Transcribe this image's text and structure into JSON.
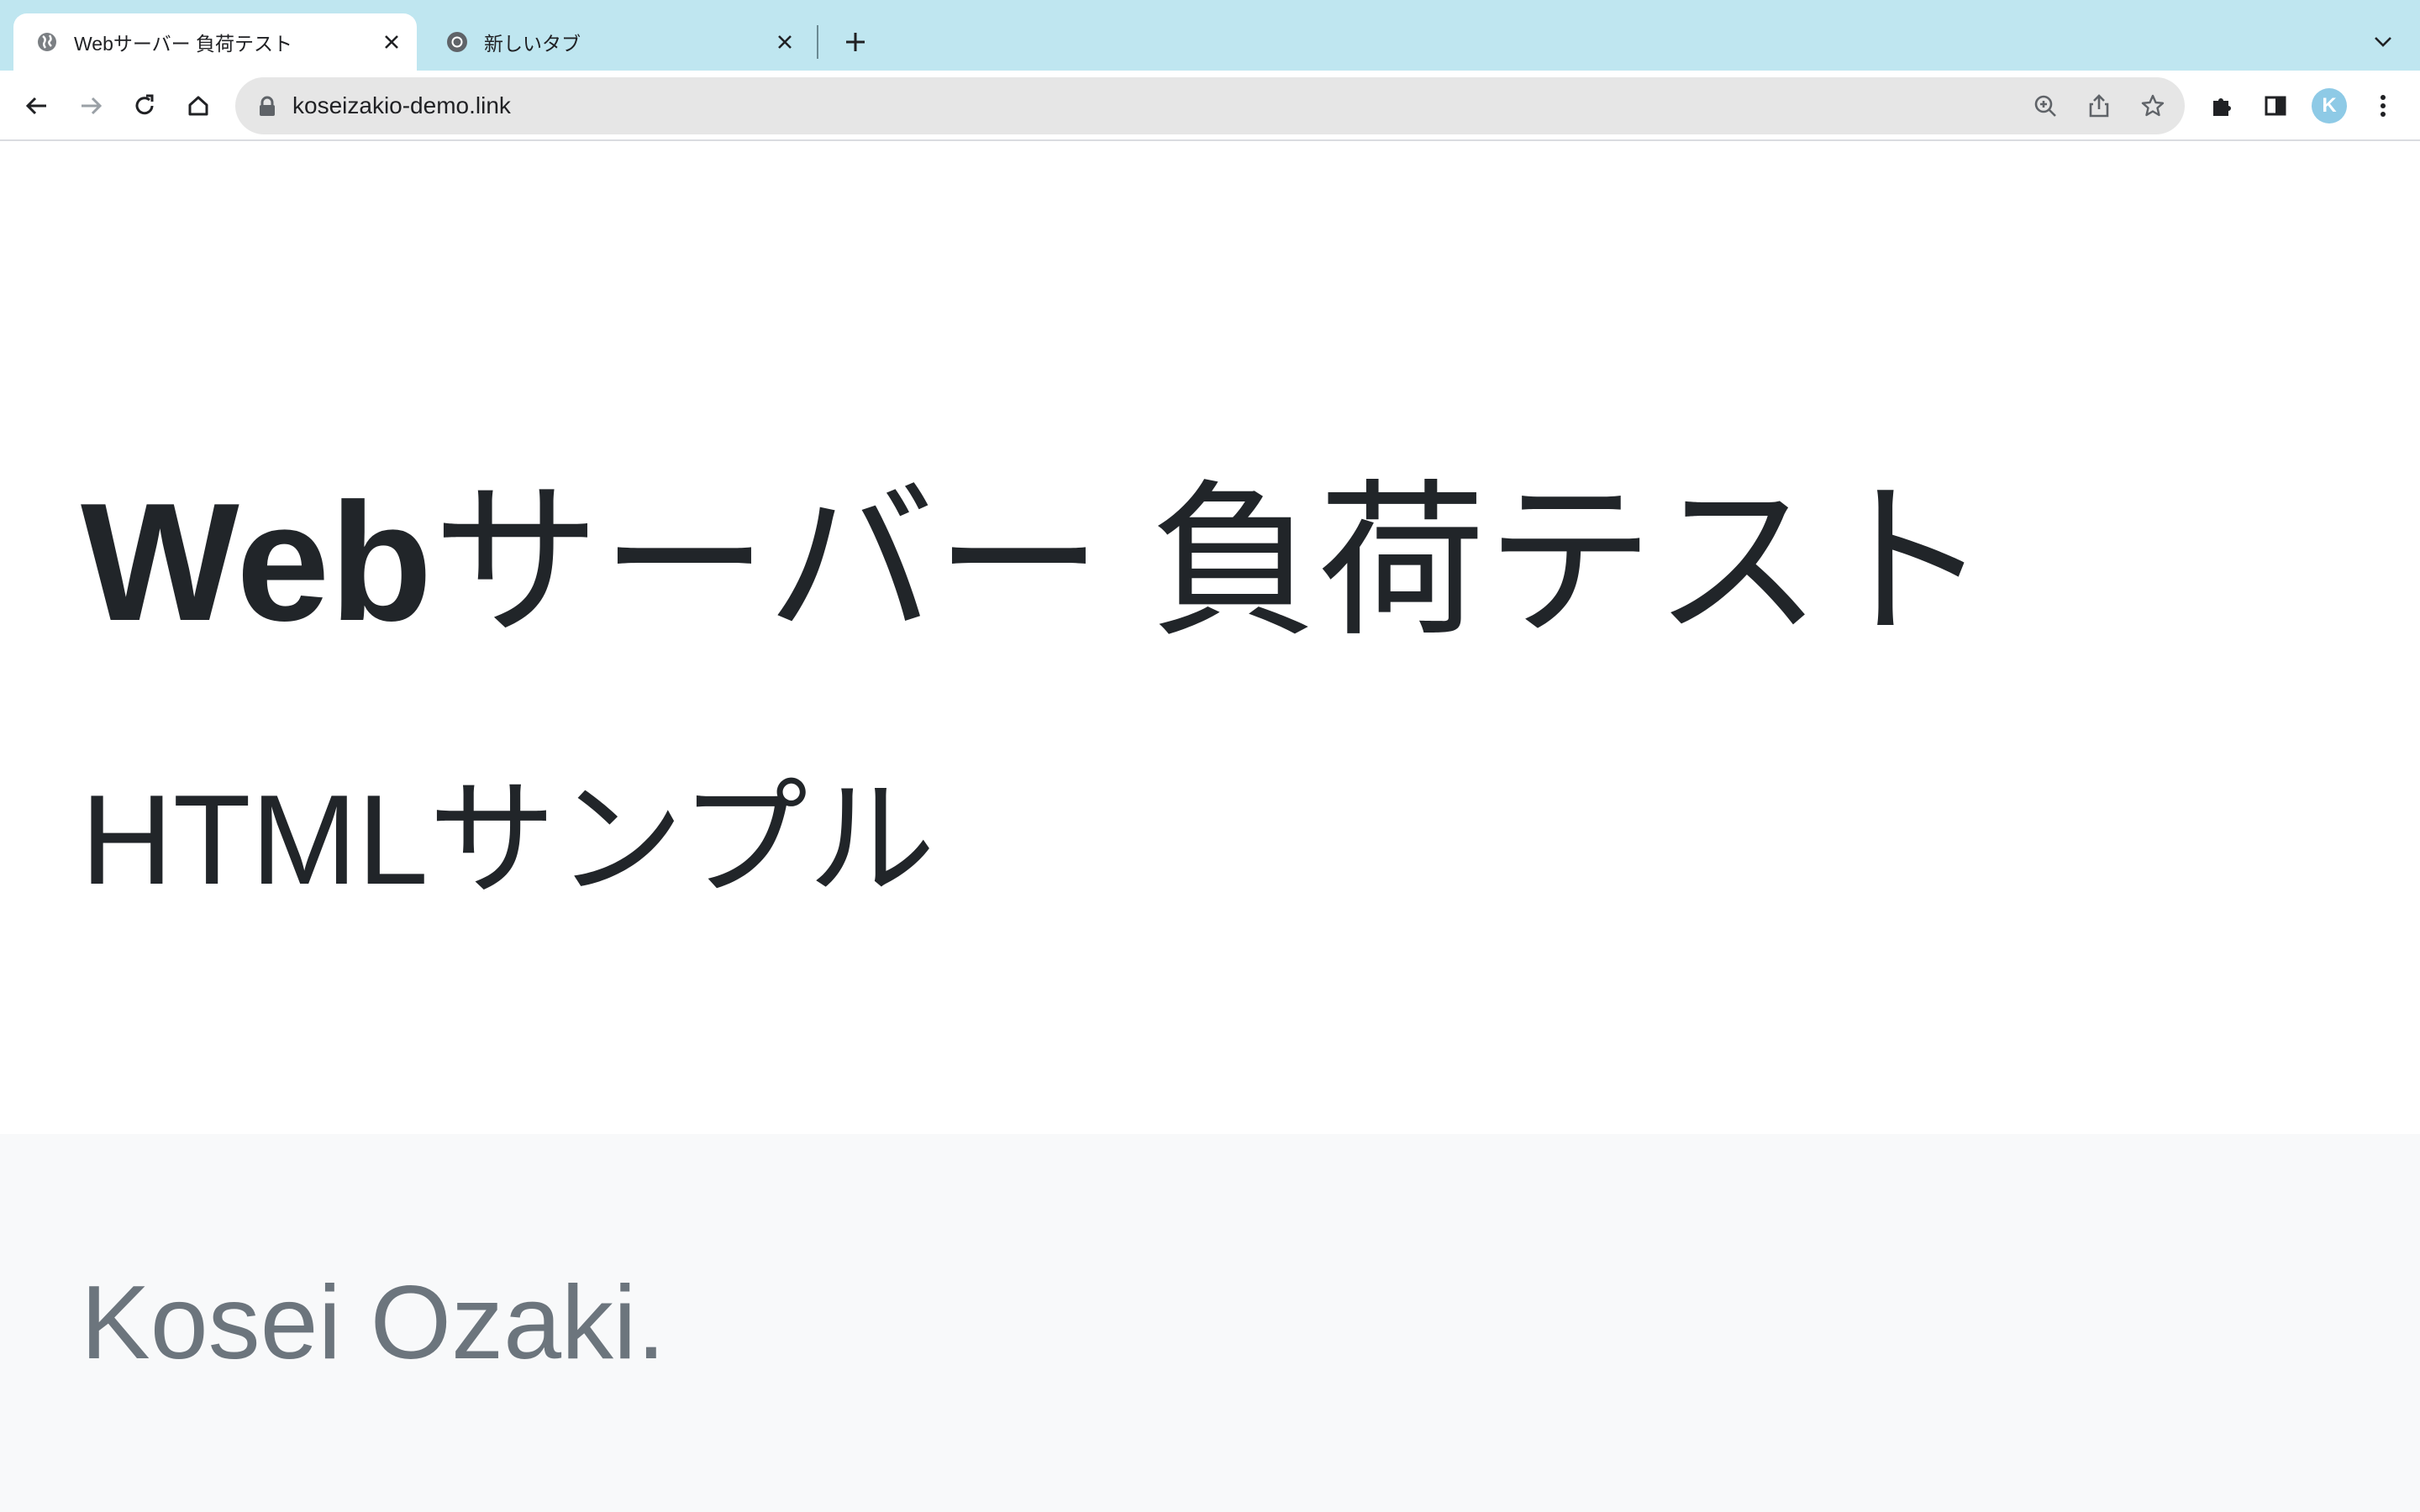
{
  "browser": {
    "tabs": [
      {
        "title": "Webサーバー 負荷テスト",
        "active": true,
        "icon": "globe-icon"
      },
      {
        "title": "新しいタブ",
        "active": false,
        "icon": "chrome-icon"
      }
    ],
    "new_tab_icon": "plus-icon",
    "tab_search_icon": "chevron-down-icon",
    "url": "koseizakio-demo.link",
    "profile_initial": "K",
    "accent_color": "#bfe6f0"
  },
  "page": {
    "title_bold": "Web",
    "title_rest": "サーバー 負荷テスト",
    "subtitle": "HTMLサンプル",
    "footer_name": "Kosei Ozaki."
  }
}
